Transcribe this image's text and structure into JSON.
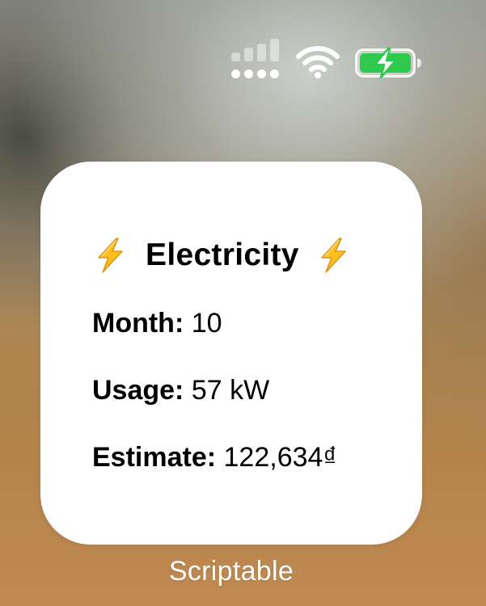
{
  "status_bar": {
    "signal_icon": "cellular-signal-icon",
    "wifi_icon": "wifi-icon",
    "battery_icon": "battery-charging-icon",
    "battery_color": "#2fc94e"
  },
  "widget": {
    "title": "Electricity",
    "title_emoji": "lightning-bolt-icon",
    "rows": [
      {
        "label": "Month:",
        "value": "10"
      },
      {
        "label": "Usage:",
        "value": "57 kW"
      },
      {
        "label": "Estimate:",
        "value": "122,634₫"
      }
    ]
  },
  "app_label": "Scriptable"
}
